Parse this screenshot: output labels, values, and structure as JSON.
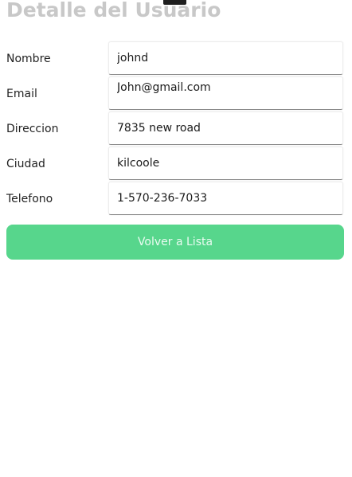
{
  "header": {
    "title": "Detalle del Usuario"
  },
  "form": {
    "fields": [
      {
        "label": "Nombre",
        "value": "johnd"
      },
      {
        "label": "Email",
        "value": "John@gmail.com"
      },
      {
        "label": "Direccion",
        "value": "7835 new road"
      },
      {
        "label": "Ciudad",
        "value": "kilcoole"
      },
      {
        "label": "Telefono",
        "value": "1-570-236-7033"
      }
    ]
  },
  "actions": {
    "back_label": "Volver a Lista"
  },
  "colors": {
    "title": "#c8c8c8",
    "button": "#57d68c",
    "button_text": "#eafbf1"
  }
}
